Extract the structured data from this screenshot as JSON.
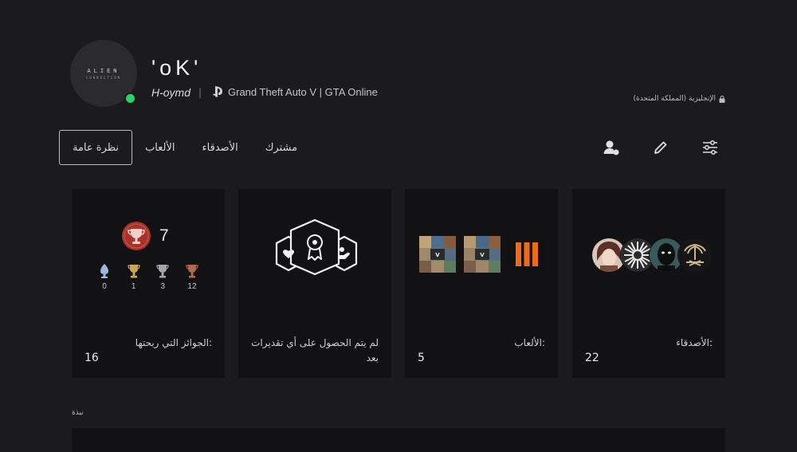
{
  "profile": {
    "avatar_text_line1": "ALIEN",
    "avatar_text_line2": "CONNECTION",
    "username": "'oK'",
    "online_id": "H-oymd",
    "separator": "|",
    "now_playing": "Grand Theft Auto V | GTA Online",
    "online_color": "#2ed06b"
  },
  "language": {
    "label": "الإنجليزية (المملكة المتحدة)",
    "icon": "lock-icon"
  },
  "nav": {
    "tabs": [
      {
        "label": "مشترك"
      },
      {
        "label": "الأصدقاء"
      },
      {
        "label": "الألعاب"
      },
      {
        "label": "نظرة عامة",
        "active": true
      }
    ],
    "actions": [
      {
        "icon": "add-friend-icon"
      },
      {
        "icon": "edit-icon"
      },
      {
        "icon": "sliders-icon"
      }
    ]
  },
  "cards": {
    "friends": {
      "label": "الأصدقاء:",
      "value": "22"
    },
    "games": {
      "label": "الألعاب:",
      "value": "5"
    },
    "awards": {
      "label": "لم يتم الحصول على أي تقديرات بعد"
    },
    "trophies": {
      "level": "7",
      "counts": {
        "bronze": "12",
        "silver": "3",
        "gold": "1",
        "platinum": "0"
      },
      "label": "الجوائز التي ربحتها:",
      "value": "16",
      "colors": {
        "level_badge": "#a8332b",
        "platinum": "#9fb7d8",
        "gold": "#c9a65a",
        "silver": "#a5a5a5",
        "bronze": "#b06a4c"
      }
    }
  },
  "section": {
    "label": "نبذة"
  }
}
